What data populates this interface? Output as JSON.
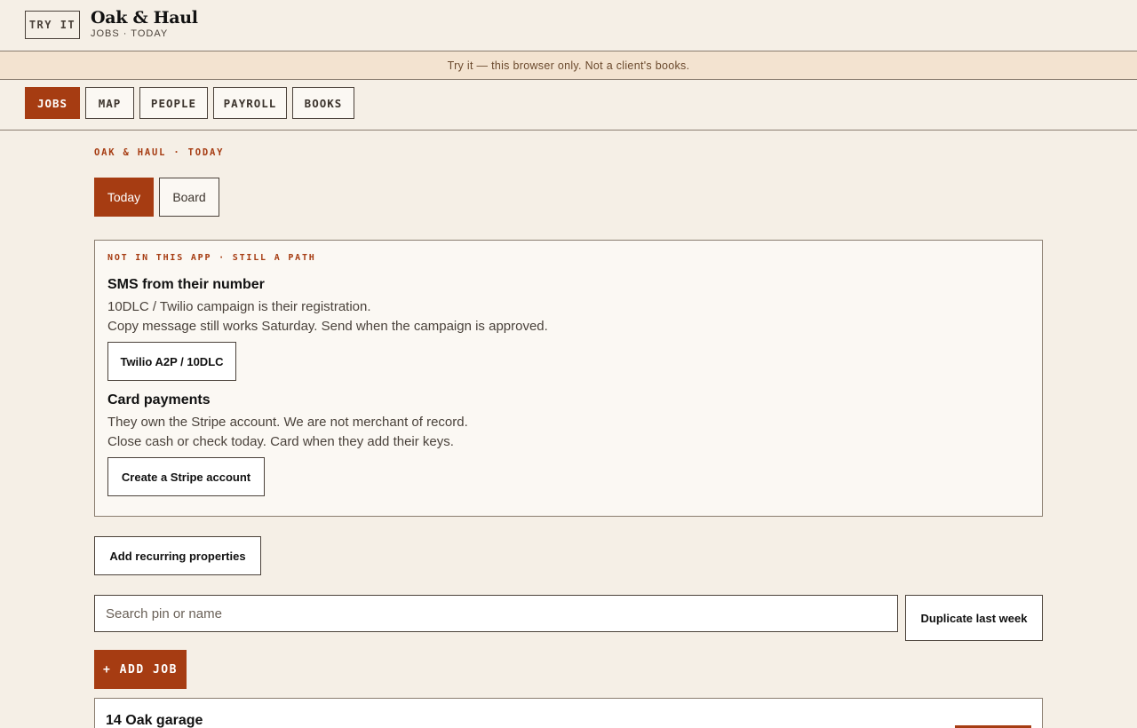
{
  "header": {
    "badge": "TRY IT",
    "brand_name": "Oak & Haul",
    "brand_sub": "JOBS · TODAY"
  },
  "notice": "Try it — this browser only. Not a client's books.",
  "nav": {
    "items": [
      {
        "label": "JOBS"
      },
      {
        "label": "MAP"
      },
      {
        "label": "PEOPLE"
      },
      {
        "label": "PAYROLL"
      },
      {
        "label": "BOOKS"
      }
    ]
  },
  "main": {
    "eyebrow": "OAK & HAUL · TODAY",
    "tabs": [
      {
        "label": "Today"
      },
      {
        "label": "Board"
      }
    ],
    "card": {
      "eyebrow": "NOT IN THIS APP · STILL A PATH",
      "sms": {
        "title": "SMS from their number",
        "line1": "10DLC / Twilio campaign is their registration.",
        "line2": "Copy message still works Saturday. Send when the campaign is approved.",
        "button": "Twilio A2P / 10DLC"
      },
      "card_payments": {
        "title": "Card payments",
        "line1": "They own the Stripe account. We are not merchant of record.",
        "line2": "Close cash or check today. Card when they add their keys.",
        "button": "Create a Stripe account"
      }
    },
    "add_recurring": "Add recurring properties",
    "search_placeholder": "Search pin or name",
    "duplicate_button": "Duplicate last week",
    "add_job": "+ ADD JOB",
    "job": {
      "title": "14 Oak garage"
    }
  },
  "colors": {
    "accent": "#a63c12",
    "background": "#f5efe6",
    "banner": "#f3e3d0"
  }
}
